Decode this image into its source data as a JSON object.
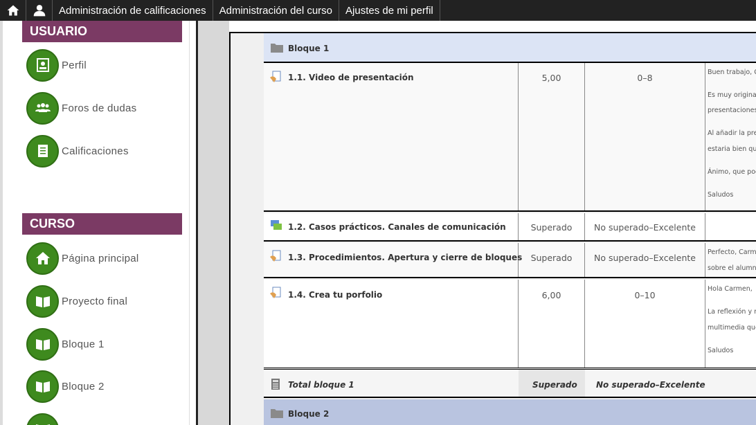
{
  "topbar": {
    "home_icon": "home-icon",
    "user_icon": "user-icon",
    "links": [
      "Administración de calificaciones",
      "Administración del curso",
      "Ajustes de mi perfil"
    ]
  },
  "sidebar": {
    "usuario_title": "USUARIO",
    "usuario_items": [
      {
        "label": "Perfil",
        "icon": "profile-icon"
      },
      {
        "label": "Foros de dudas",
        "icon": "group-icon"
      },
      {
        "label": "Calificaciones",
        "icon": "grades-icon"
      }
    ],
    "curso_title": "CURSO",
    "curso_items": [
      {
        "label": "Página principal",
        "icon": "home-icon"
      },
      {
        "label": "Proyecto final",
        "icon": "book-icon"
      },
      {
        "label": "Bloque 1",
        "icon": "book-icon"
      },
      {
        "label": "Bloque 2",
        "icon": "book-icon"
      },
      {
        "label": "",
        "icon": "book-icon"
      }
    ],
    "accent": "#7b3a64",
    "icon_green": "#3e8a1e"
  },
  "table": {
    "block1": "Bloque 1",
    "block2": "Bloque 2",
    "items": [
      {
        "title": "1.1. Video de presentación",
        "grade": "5,00",
        "range": "0–8",
        "feedback": [
          "Buen trabajo, C",
          "Es muy original",
          "presentaciones,",
          "Al añadir la pre",
          "estaria bien qu",
          "Ánimo, que poc",
          "Saludos"
        ],
        "icon": "assignment-icon"
      },
      {
        "title": "1.2. Casos prácticos. Canales de comunicación",
        "grade": "Superado",
        "range": "No superado–Excelente",
        "feedback": [],
        "icon": "forum-icon"
      },
      {
        "title": "1.3. Procedimientos. Apertura y cierre de bloques",
        "grade": "Superado",
        "range": "No superado–Excelente",
        "feedback": [
          "Perfecto, Carm",
          "sobre el alumno"
        ],
        "icon": "assignment-icon"
      },
      {
        "title": "1.4. Crea tu porfolio",
        "grade": "6,00",
        "range": "0–10",
        "feedback": [
          "Hola Carmen,",
          "La reflexión y r",
          "multimedia que",
          "Saludos"
        ],
        "icon": "assignment-icon"
      }
    ],
    "total": {
      "label": "Total bloque 1",
      "grade": "Superado",
      "range": "No superado–Excelente"
    }
  }
}
